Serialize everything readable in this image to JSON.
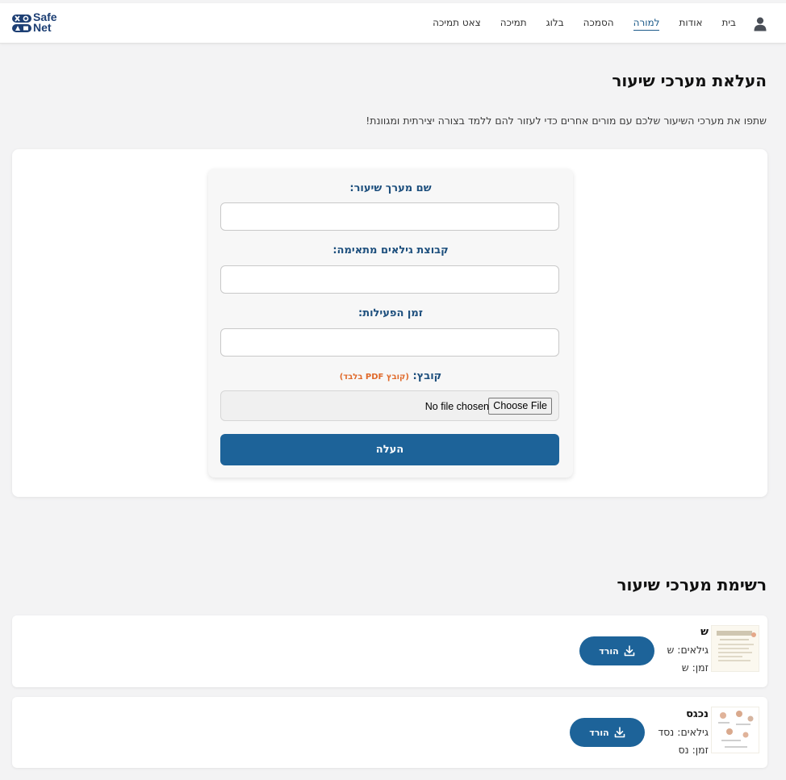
{
  "brand": {
    "line1": "Safe",
    "line2": "Net"
  },
  "nav": {
    "items": [
      {
        "label": "בית"
      },
      {
        "label": "אודות"
      },
      {
        "label": "למורה",
        "active": true
      },
      {
        "label": "הסמכה"
      },
      {
        "label": "בלוג"
      },
      {
        "label": "תמיכה"
      },
      {
        "label": "צאט תמיכה"
      }
    ]
  },
  "header": {
    "title": "העלאת מערכי שיעור",
    "subtitle": "שתפו את מערכי השיעור שלכם עם מורים אחרים כדי לעזור להם ללמד בצורה יצירתית ומגוונת!"
  },
  "form": {
    "name_label": "שם מערך שיעור:",
    "name_value": "",
    "age_label": "קבוצת גילאים מתאימה:",
    "age_value": "",
    "time_label": "זמן הפעילות:",
    "time_value": "",
    "file_label": "קובץ:",
    "file_hint": "(קובץ PDF בלבד)",
    "file_button": "Choose File",
    "file_status": "No file chosen",
    "submit_label": "העלה"
  },
  "list": {
    "title": "רשימת מערכי שיעור",
    "download_label": "הורד",
    "lessons": [
      {
        "name": "ש",
        "ages_prefix": "גילאים:",
        "ages": "ש",
        "time_prefix": "זמן:",
        "time": "ש"
      },
      {
        "name": "נכגס",
        "ages_prefix": "גילאים:",
        "ages": "נסד",
        "time_prefix": "זמן:",
        "time": "נס"
      }
    ]
  },
  "colors": {
    "primary": "#1d6399",
    "label": "#1d4f7d",
    "hint": "#e06a2b",
    "background": "#f3f3f4"
  }
}
